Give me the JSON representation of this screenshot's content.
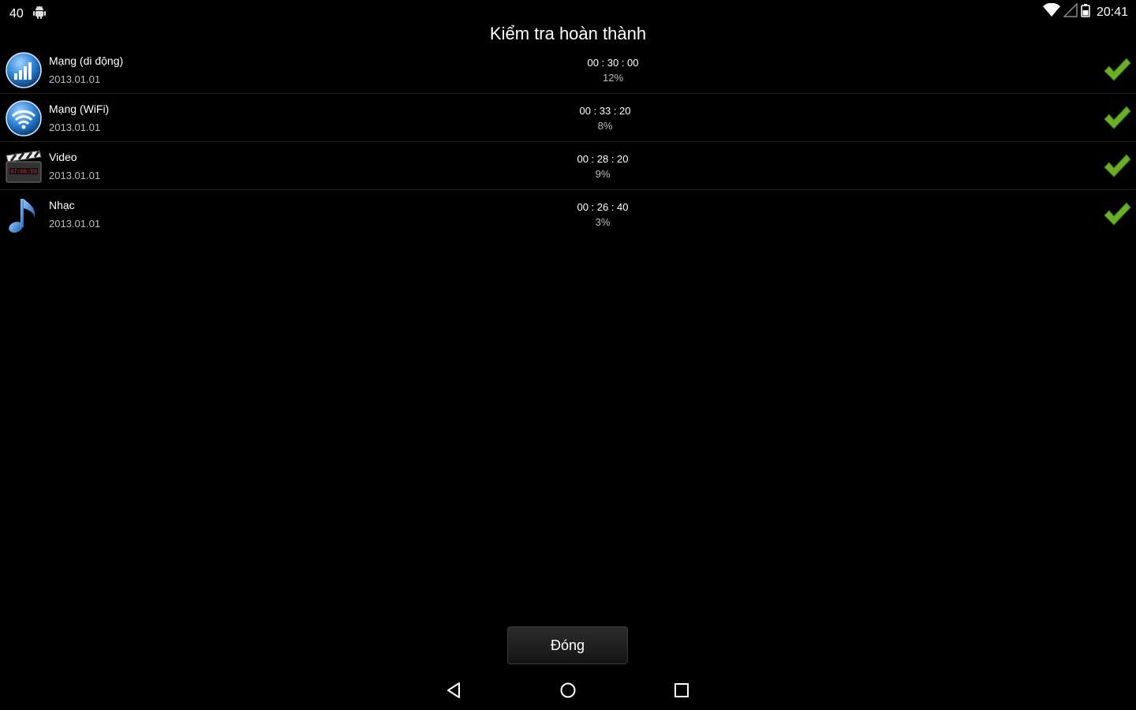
{
  "status_bar": {
    "notification_count": "40",
    "icons": [
      "android-icon",
      "wifi-icon",
      "signal-icon",
      "battery-icon"
    ],
    "time": "20:41"
  },
  "dialog": {
    "title": "Kiểm tra hoàn thành",
    "close_label": "Đóng"
  },
  "items": [
    {
      "name": "Mạng (di động)",
      "date": "2013.01.01",
      "time": "00 : 30 : 00",
      "percent": "12%",
      "icon": "mobile-network-icon",
      "status": "check-icon"
    },
    {
      "name": "Mạng (WiFi)",
      "date": "2013.01.01",
      "time": "00 : 33 : 20",
      "percent": "8%",
      "icon": "wifi-network-icon",
      "status": "check-icon"
    },
    {
      "name": "Video",
      "date": "2013.01.01",
      "time": "00 : 28 : 20",
      "percent": "9%",
      "icon": "video-clapper-icon",
      "status": "check-icon"
    },
    {
      "name": "Nhạc",
      "date": "2013.01.01",
      "time": "00 : 26 : 40",
      "percent": "3%",
      "icon": "music-note-icon",
      "status": "check-icon"
    }
  ],
  "nav_bar": {
    "icons": [
      "back-icon",
      "home-icon",
      "recents-icon"
    ]
  },
  "colors": {
    "background": "#000000",
    "check_green": "#6ab023",
    "icon_blue": "#2a7fd4"
  }
}
